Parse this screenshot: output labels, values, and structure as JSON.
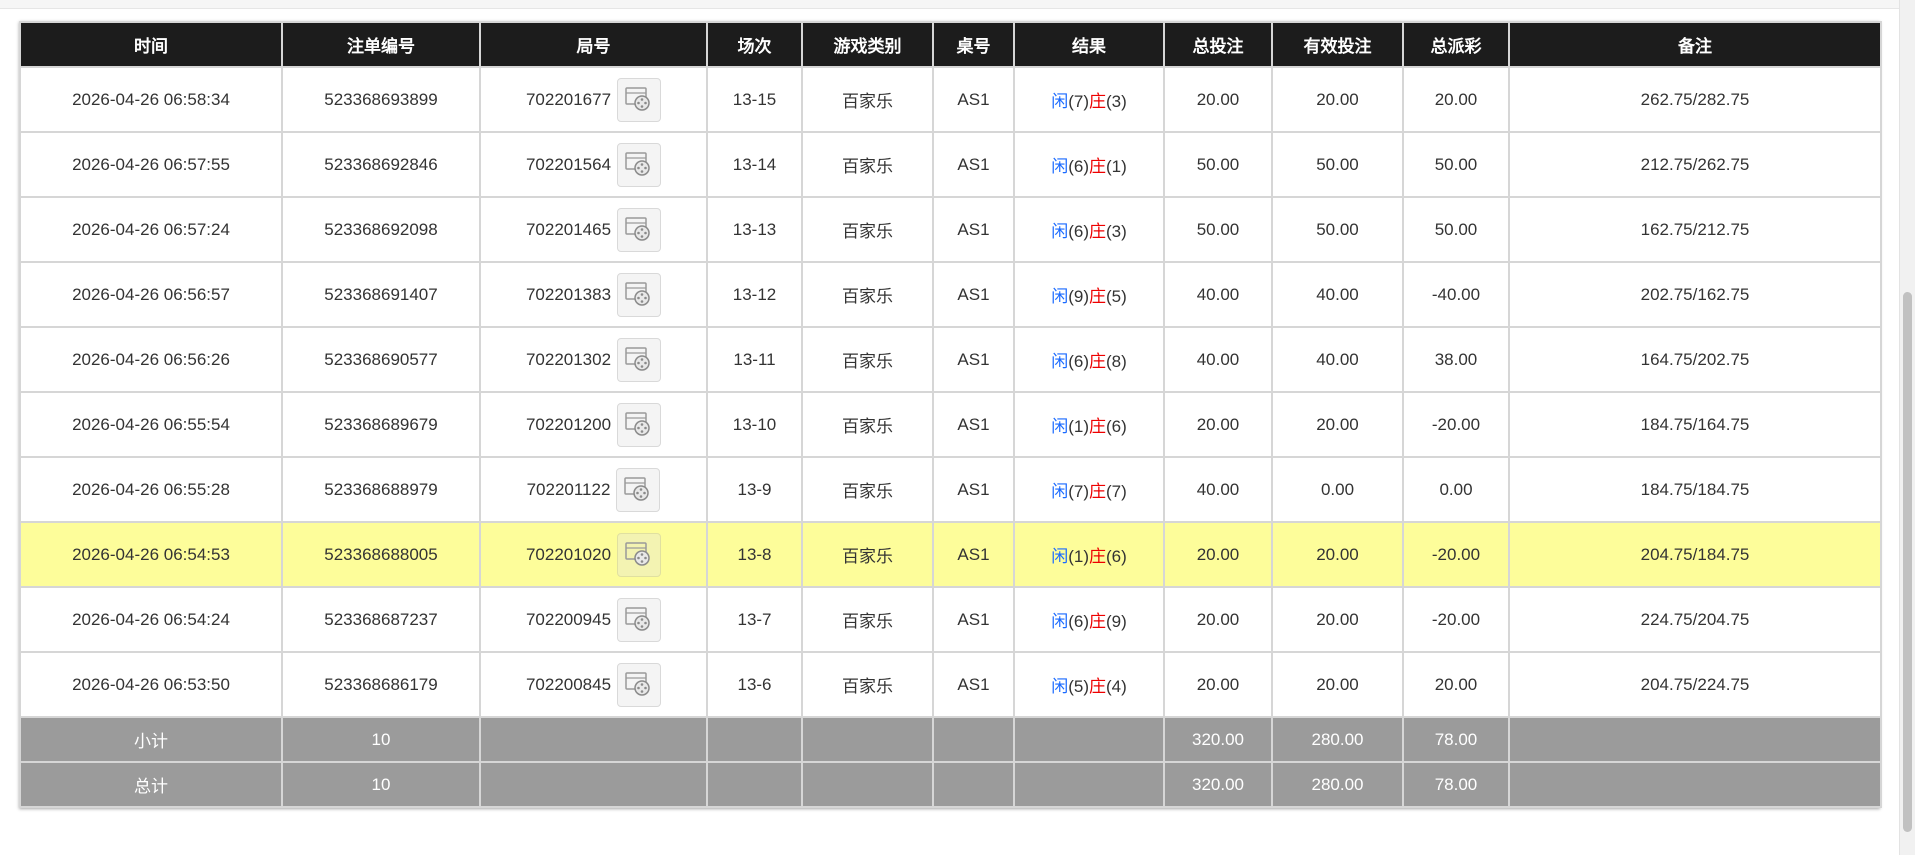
{
  "table": {
    "columns": [
      "时间",
      "注单编号",
      "局号",
      "场次",
      "游戏类别",
      "桌号",
      "结果",
      "总投注",
      "有效投注",
      "总派彩",
      "备注"
    ],
    "rows": [
      {
        "time": "2026-04-26 06:58:34",
        "order_no": "523368693899",
        "round_no": "702201677",
        "session": "13-15",
        "game_type": "百家乐",
        "table_no": "AS1",
        "player_label": "闲",
        "player_score": "(7)",
        "banker_label": "庄",
        "banker_score": "(3)",
        "total_bet": "20.00",
        "valid_bet": "20.00",
        "payout": "20.00",
        "payout_negative": false,
        "remark": "262.75/282.75",
        "highlighted": false
      },
      {
        "time": "2026-04-26 06:57:55",
        "order_no": "523368692846",
        "round_no": "702201564",
        "session": "13-14",
        "game_type": "百家乐",
        "table_no": "AS1",
        "player_label": "闲",
        "player_score": "(6)",
        "banker_label": "庄",
        "banker_score": "(1)",
        "total_bet": "50.00",
        "valid_bet": "50.00",
        "payout": "50.00",
        "payout_negative": false,
        "remark": "212.75/262.75",
        "highlighted": false
      },
      {
        "time": "2026-04-26 06:57:24",
        "order_no": "523368692098",
        "round_no": "702201465",
        "session": "13-13",
        "game_type": "百家乐",
        "table_no": "AS1",
        "player_label": "闲",
        "player_score": "(6)",
        "banker_label": "庄",
        "banker_score": "(3)",
        "total_bet": "50.00",
        "valid_bet": "50.00",
        "payout": "50.00",
        "payout_negative": false,
        "remark": "162.75/212.75",
        "highlighted": false
      },
      {
        "time": "2026-04-26 06:56:57",
        "order_no": "523368691407",
        "round_no": "702201383",
        "session": "13-12",
        "game_type": "百家乐",
        "table_no": "AS1",
        "player_label": "闲",
        "player_score": "(9)",
        "banker_label": "庄",
        "banker_score": "(5)",
        "total_bet": "40.00",
        "valid_bet": "40.00",
        "payout": "-40.00",
        "payout_negative": true,
        "remark": "202.75/162.75",
        "highlighted": false
      },
      {
        "time": "2026-04-26 06:56:26",
        "order_no": "523368690577",
        "round_no": "702201302",
        "session": "13-11",
        "game_type": "百家乐",
        "table_no": "AS1",
        "player_label": "闲",
        "player_score": "(6)",
        "banker_label": "庄",
        "banker_score": "(8)",
        "total_bet": "40.00",
        "valid_bet": "40.00",
        "payout": "38.00",
        "payout_negative": false,
        "remark": "164.75/202.75",
        "highlighted": false
      },
      {
        "time": "2026-04-26 06:55:54",
        "order_no": "523368689679",
        "round_no": "702201200",
        "session": "13-10",
        "game_type": "百家乐",
        "table_no": "AS1",
        "player_label": "闲",
        "player_score": "(1)",
        "banker_label": "庄",
        "banker_score": "(6)",
        "total_bet": "20.00",
        "valid_bet": "20.00",
        "payout": "-20.00",
        "payout_negative": true,
        "remark": "184.75/164.75",
        "highlighted": false
      },
      {
        "time": "2026-04-26 06:55:28",
        "order_no": "523368688979",
        "round_no": "702201122",
        "session": "13-9",
        "game_type": "百家乐",
        "table_no": "AS1",
        "player_label": "闲",
        "player_score": "(7)",
        "banker_label": "庄",
        "banker_score": "(7)",
        "total_bet": "40.00",
        "valid_bet": "0.00",
        "payout": "0.00",
        "payout_negative": false,
        "remark": "184.75/184.75",
        "highlighted": false
      },
      {
        "time": "2026-04-26 06:54:53",
        "order_no": "523368688005",
        "round_no": "702201020",
        "session": "13-8",
        "game_type": "百家乐",
        "table_no": "AS1",
        "player_label": "闲",
        "player_score": "(1)",
        "banker_label": "庄",
        "banker_score": "(6)",
        "total_bet": "20.00",
        "valid_bet": "20.00",
        "payout": "-20.00",
        "payout_negative": true,
        "remark": "204.75/184.75",
        "highlighted": true
      },
      {
        "time": "2026-04-26 06:54:24",
        "order_no": "523368687237",
        "round_no": "702200945",
        "session": "13-7",
        "game_type": "百家乐",
        "table_no": "AS1",
        "player_label": "闲",
        "player_score": "(6)",
        "banker_label": "庄",
        "banker_score": "(9)",
        "total_bet": "20.00",
        "valid_bet": "20.00",
        "payout": "-20.00",
        "payout_negative": true,
        "remark": "224.75/204.75",
        "highlighted": false
      },
      {
        "time": "2026-04-26 06:53:50",
        "order_no": "523368686179",
        "round_no": "702200845",
        "session": "13-6",
        "game_type": "百家乐",
        "table_no": "AS1",
        "player_label": "闲",
        "player_score": "(5)",
        "banker_label": "庄",
        "banker_score": "(4)",
        "total_bet": "20.00",
        "valid_bet": "20.00",
        "payout": "20.00",
        "payout_negative": false,
        "remark": "204.75/224.75",
        "highlighted": false
      }
    ],
    "subtotal": {
      "label": "小计",
      "count": "10",
      "total_bet": "320.00",
      "valid_bet": "280.00",
      "payout": "78.00"
    },
    "grand_total": {
      "label": "总计",
      "count": "10",
      "total_bet": "320.00",
      "valid_bet": "280.00",
      "payout": "78.00"
    }
  },
  "colors": {
    "header_bg": "#1c1c1c",
    "player_blue": "#1a6aff",
    "banker_red": "#ee0000",
    "highlight_row": "#fdfd9a",
    "summary_bg": "#9b9b9b"
  },
  "icons": {
    "replay": "video-replay-icon"
  }
}
